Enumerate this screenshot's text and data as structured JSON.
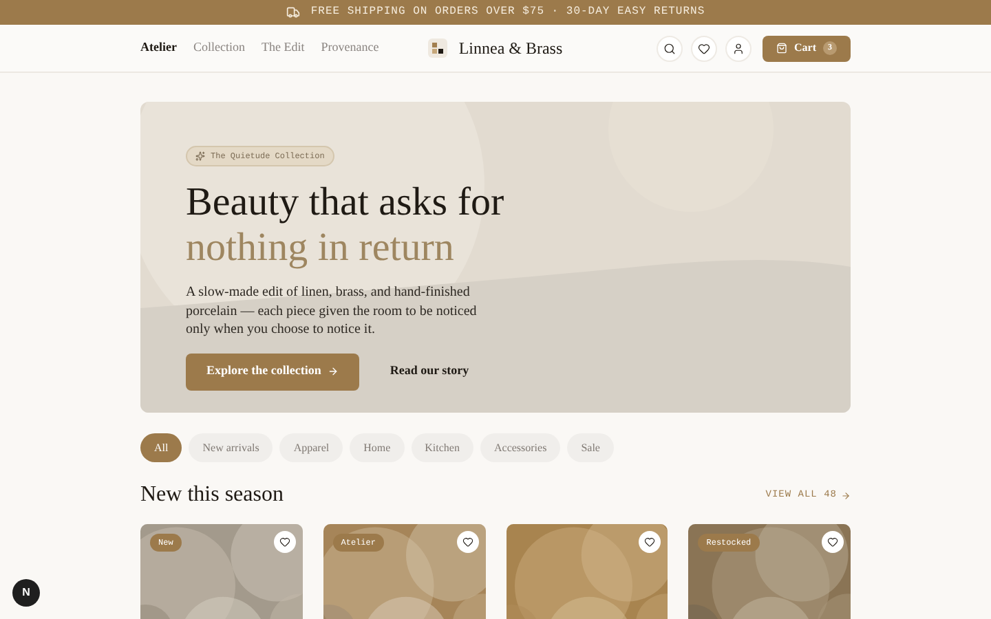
{
  "announcement": {
    "text": "FREE SHIPPING ON ORDERS OVER $75 · 30-DAY EASY RETURNS"
  },
  "nav": [
    {
      "label": "Atelier",
      "selected": true
    },
    {
      "label": "Collection",
      "selected": false
    },
    {
      "label": "The Edit",
      "selected": false
    },
    {
      "label": "Provenance",
      "selected": false
    }
  ],
  "brand": {
    "name": "Linnea & Brass"
  },
  "cart": {
    "label": "Cart",
    "count": "3"
  },
  "hero": {
    "tag": "The Quietude Collection",
    "title_line_1": "Beauty that asks for",
    "title_line_2": "nothing in return",
    "body": "A slow-made edit of linen, brass, and hand-finished porcelain — each piece given the room to be noticed only when you choose to notice it.",
    "primary_button": "Explore the collection",
    "secondary_link": "Read our story"
  },
  "filters": [
    {
      "label": "All",
      "selected": true
    },
    {
      "label": "New arrivals",
      "selected": false
    },
    {
      "label": "Apparel",
      "selected": false
    },
    {
      "label": "Home",
      "selected": false
    },
    {
      "label": "Kitchen",
      "selected": false
    },
    {
      "label": "Accessories",
      "selected": false
    },
    {
      "label": "Sale",
      "selected": false
    }
  ],
  "section": {
    "title": "New this season",
    "view_all": "VIEW ALL 48"
  },
  "products": [
    {
      "kind": "picture",
      "badge": "New"
    },
    {
      "kind": "picture",
      "badge": "Atelier"
    },
    {
      "kind": "picture"
    },
    {
      "kind": "picture",
      "badge": "Restocked"
    }
  ],
  "floating_button": {
    "label": "N"
  }
}
